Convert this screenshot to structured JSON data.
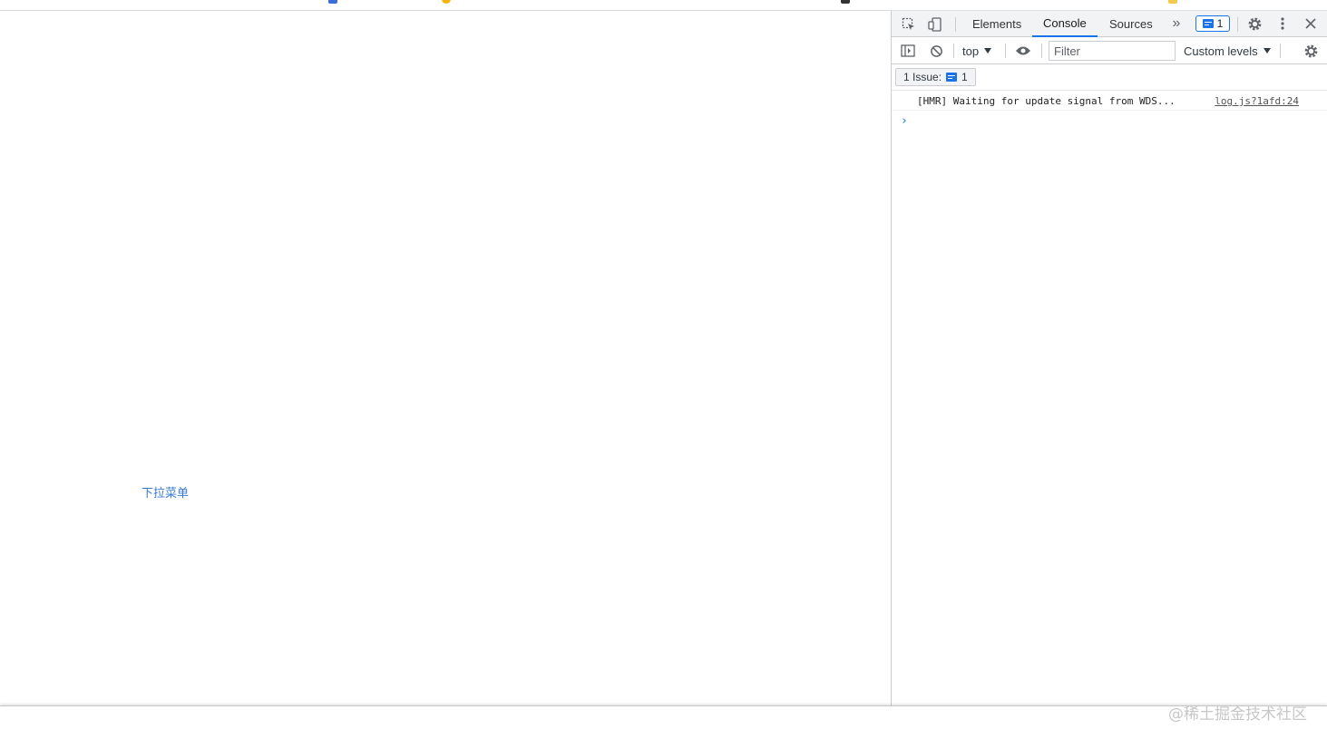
{
  "page": {
    "dropdown_link": "下拉菜单"
  },
  "devtools": {
    "tabs": [
      {
        "label": "Elements"
      },
      {
        "label": "Console"
      },
      {
        "label": "Sources"
      }
    ],
    "more_tabs_glyph": "»",
    "issues_badge_count": "1",
    "toolbar": {
      "context": "top",
      "filter_placeholder": "Filter",
      "levels": "Custom levels"
    },
    "issues_bar": {
      "label": "1 Issue:",
      "count": "1"
    },
    "console": {
      "message": "[HMR] Waiting for update signal from WDS...",
      "source": "log.js?1afd:24",
      "prompt": "›"
    }
  },
  "watermark": "@稀土掘金技术社区",
  "colors": {
    "accent": "#1a73e8",
    "link": "#3a7bd5",
    "panel_bg": "#f1f3f4",
    "border": "#cbcdd1"
  }
}
